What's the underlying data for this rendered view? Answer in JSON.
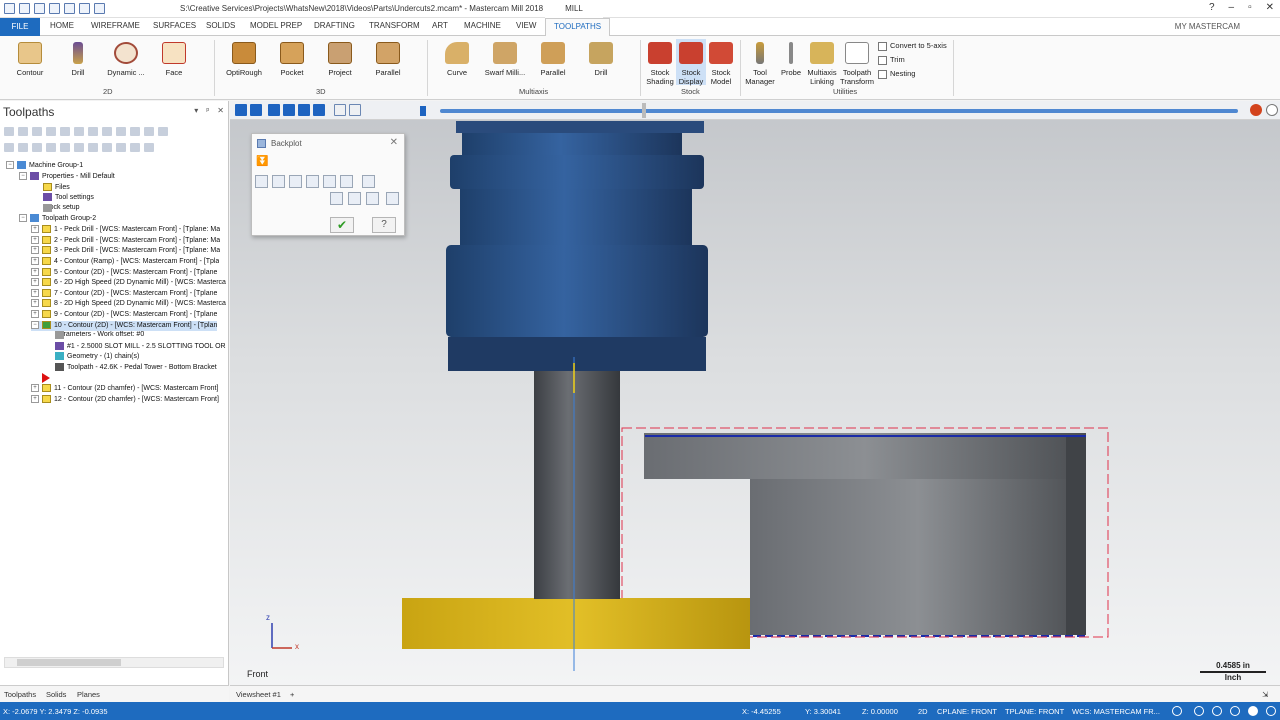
{
  "window": {
    "title": "S:\\Creative Services\\Projects\\WhatsNew\\2018\\Videos\\Parts\\Undercuts2.mcam* - Mastercam Mill 2018",
    "context_tab": "MILL"
  },
  "ribbon_tabs": {
    "file": "FILE",
    "items": [
      "HOME",
      "WIREFRAME",
      "SURFACES",
      "SOLIDS",
      "MODEL PREP",
      "DRAFTING",
      "TRANSFORM",
      "ART",
      "MACHINE",
      "VIEW"
    ],
    "active": "TOOLPATHS",
    "account": "MY MASTERCAM"
  },
  "ribbon": {
    "group_2d": {
      "label": "2D",
      "buttons": [
        "Contour",
        "Drill",
        "Dynamic ...",
        "Face"
      ]
    },
    "group_3d": {
      "label": "3D",
      "buttons": [
        "OptiRough",
        "Pocket",
        "Project",
        "Parallel"
      ]
    },
    "group_multiaxis": {
      "label": "Multiaxis",
      "buttons": [
        "Curve",
        "Swarf Milli...",
        "Parallel",
        "Drill"
      ]
    },
    "group_stock": {
      "label": "Stock",
      "buttons": [
        {
          "l1": "Stock",
          "l2": "Shading"
        },
        {
          "l1": "Stock",
          "l2": "Display"
        },
        {
          "l1": "Stock",
          "l2": "Model"
        }
      ]
    },
    "group_utilities": {
      "label": "Utilities",
      "buttons": [
        {
          "l1": "Tool",
          "l2": "Manager"
        },
        {
          "l1": "Probe",
          "l2": ""
        },
        {
          "l1": "Multiaxis",
          "l2": "Linking"
        },
        {
          "l1": "Toolpath",
          "l2": "Transform"
        }
      ],
      "small": [
        "Convert to 5-axis",
        "Trim",
        "Nesting"
      ]
    }
  },
  "left_panel": {
    "title": "Toolpaths",
    "tree": {
      "machine_group": "Machine Group-1",
      "properties": "Properties - Mill Default",
      "files": "Files",
      "tool_settings": "Tool settings",
      "stock_setup": "Stock setup",
      "toolpath_group": "Toolpath Group-2",
      "ops": [
        "1 - Peck Drill - [WCS: Mastercam Front] - [Tplane: Ma",
        "2 - Peck Drill - [WCS: Mastercam Front] - [Tplane: Ma",
        "3 - Peck Drill - [WCS: Mastercam Front] - [Tplane: Ma",
        "4 - Contour (Ramp) - [WCS: Mastercam Front] - [Tpla",
        "5 - Contour (2D) - [WCS: Mastercam Front] - [Tplane",
        "6 - 2D High Speed (2D Dynamic Mill) - [WCS: Masterca",
        "7 - Contour (2D) - [WCS: Mastercam Front] - [Tplane",
        "8 - 2D High Speed (2D Dynamic Mill) - [WCS: Masterca",
        "9 - Contour (2D) - [WCS: Mastercam Front] - [Tplane",
        "10 - Contour (2D) - [WCS: Mastercam Front] - [Tplan"
      ],
      "op10_children": [
        "Parameters - Work offset: #0",
        "#1 - 2.5000 SLOT MILL - 2.5 SLOTTING TOOL OR",
        "Geometry - (1) chain(s)",
        "Toolpath - 42.6K - Pedal Tower - Bottom Bracket"
      ],
      "ops_after": [
        "11 - Contour (2D chamfer) - [WCS: Mastercam Front]",
        "12 - Contour (2D chamfer) - [WCS: Mastercam Front]"
      ]
    },
    "bottom_tabs": [
      "Toolpaths",
      "Solids",
      "Planes"
    ]
  },
  "backplot": {
    "title": "Backplot"
  },
  "viewport": {
    "view_name": "Front",
    "axis_z": "z",
    "axis_x": "x",
    "scale_value": "0.4585 in",
    "scale_unit": "Inch"
  },
  "sheet_bar": {
    "tab": "Viewsheet #1",
    "add": "+"
  },
  "status": {
    "left_coords": "X: -2.0679    Y: 2.3479    Z: -0.0935",
    "x": "X:   -4.45255",
    "y": "Y:   3.30041",
    "z": "Z:   0.00000",
    "mode": "2D",
    "cplane": "CPLANE: FRONT",
    "tplane": "TPLANE: FRONT",
    "wcs": "WCS: MASTERCAM FR..."
  },
  "colors": {
    "accent": "#1e6bbf",
    "tool": "#2f5f9e",
    "shank": "#5a5d62",
    "stock": "#d8b316",
    "part": "#6c6f74"
  }
}
